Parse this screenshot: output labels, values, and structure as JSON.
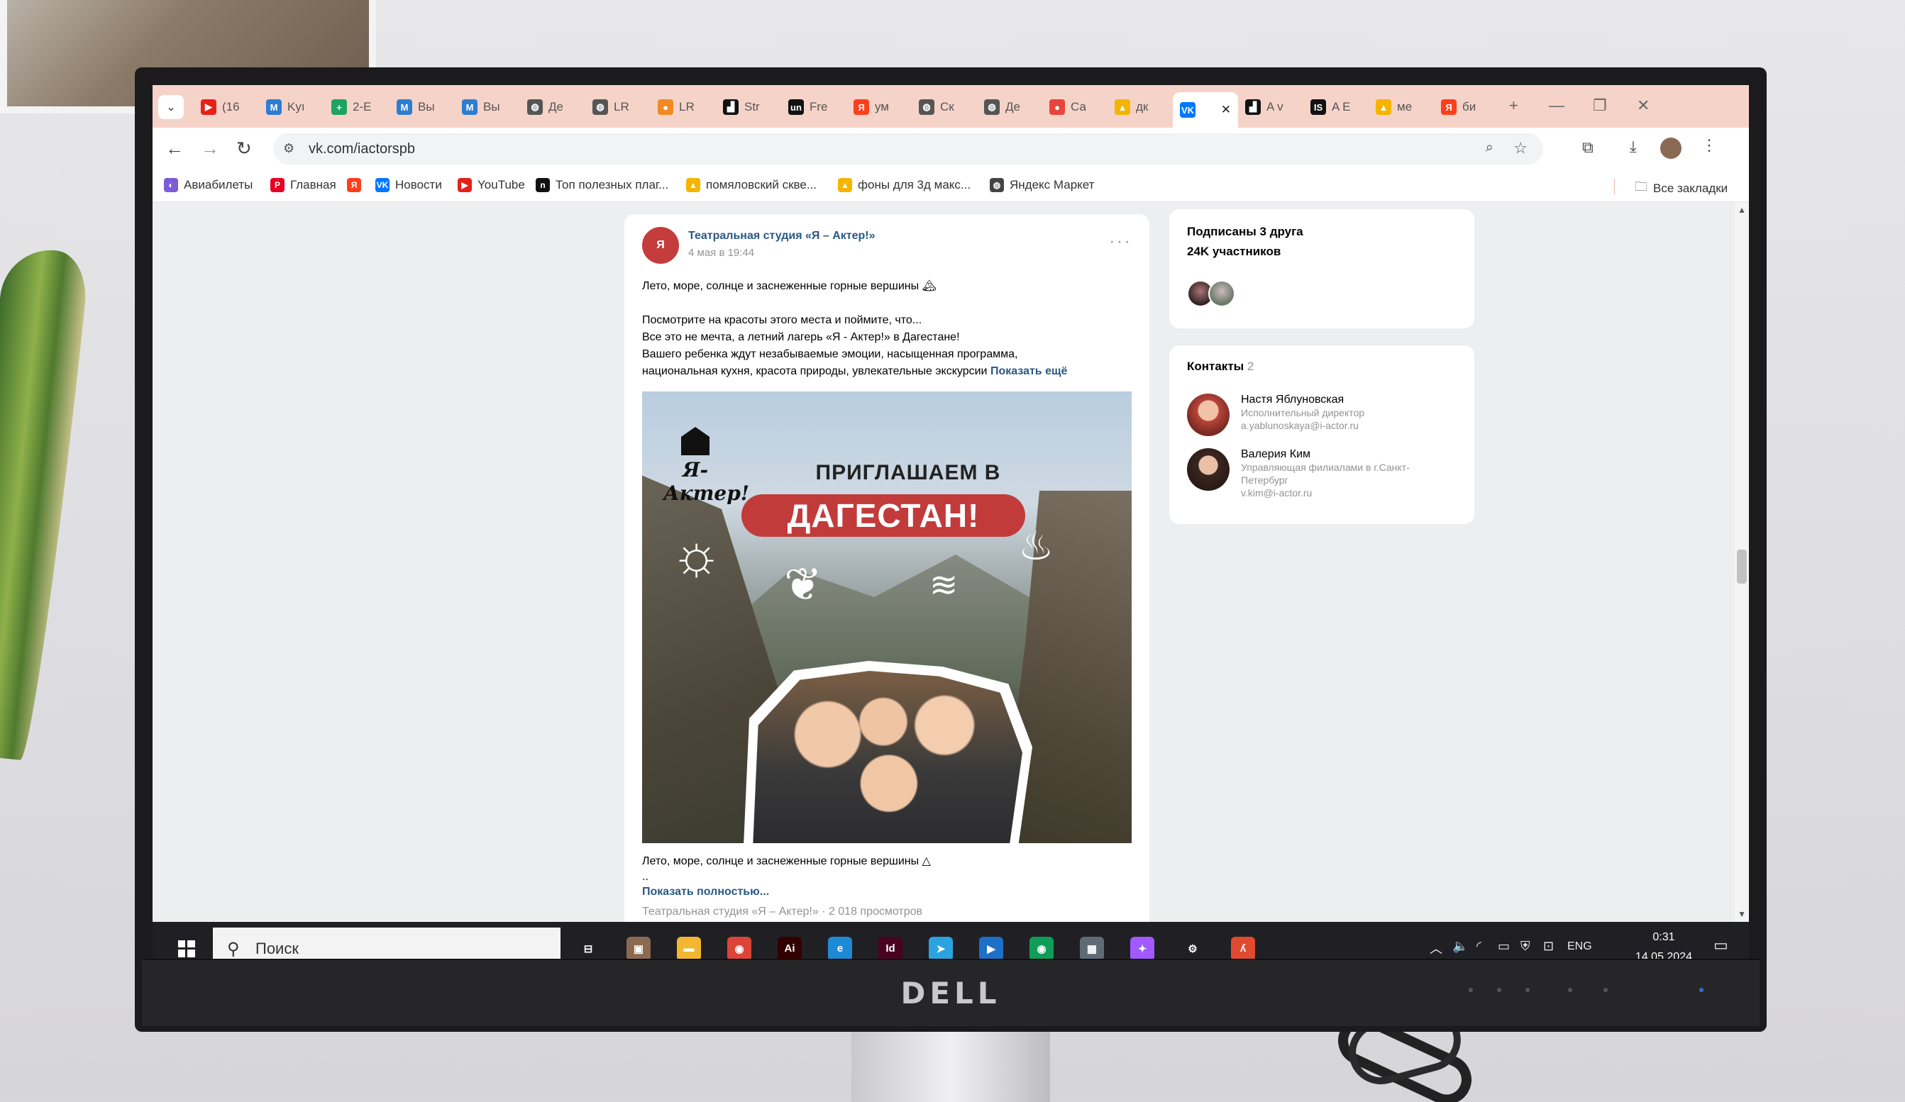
{
  "browser": {
    "tabs": [
      {
        "label": "(16",
        "icon": "youtube-icon",
        "color": "#e62117",
        "glyph": "▶"
      },
      {
        "label": "Kyı",
        "icon": "m-icon",
        "color": "#2d7dd2",
        "glyph": "M"
      },
      {
        "label": "2-E",
        "icon": "sheets-icon",
        "color": "#1ea362",
        "glyph": "+"
      },
      {
        "label": "Вы",
        "icon": "m-icon",
        "color": "#2d7dd2",
        "glyph": "M"
      },
      {
        "label": "Вы",
        "icon": "m-icon",
        "color": "#2d7dd2",
        "glyph": "M"
      },
      {
        "label": "Де",
        "icon": "globe-icon",
        "color": "#555555",
        "glyph": "◍"
      },
      {
        "label": "LR",
        "icon": "globe-icon",
        "color": "#555555",
        "glyph": "◍"
      },
      {
        "label": "LR",
        "icon": "lr-icon",
        "color": "#f08a24",
        "glyph": "●"
      },
      {
        "label": "Str",
        "icon": "str-icon",
        "color": "#111111",
        "glyph": "▟"
      },
      {
        "label": "Fre",
        "icon": "unsplash-icon",
        "color": "#111111",
        "glyph": "un"
      },
      {
        "label": "ум",
        "icon": "yandex-icon",
        "color": "#fc3f1d",
        "glyph": "Я"
      },
      {
        "label": "Ск",
        "icon": "globe-icon",
        "color": "#555555",
        "glyph": "◍"
      },
      {
        "label": "Де",
        "icon": "globe-icon",
        "color": "#555555",
        "glyph": "◍"
      },
      {
        "label": "Са",
        "icon": "maps-pin-icon",
        "color": "#e8453c",
        "glyph": "●"
      },
      {
        "label": "дк",
        "icon": "image-icon",
        "color": "#f5b400",
        "glyph": "▲"
      },
      {
        "label": "",
        "icon": "vk-icon",
        "color": "#0077ff",
        "glyph": "VK",
        "active": true
      },
      {
        "label": "A v",
        "icon": "str-icon",
        "color": "#111111",
        "glyph": "▟"
      },
      {
        "label": "A E",
        "icon": "is-icon",
        "color": "#111111",
        "glyph": "IS"
      },
      {
        "label": "ме",
        "icon": "image-icon",
        "color": "#f5b400",
        "glyph": "▲"
      },
      {
        "label": "би",
        "icon": "yandex-icon",
        "color": "#fc3f1d",
        "glyph": "Я"
      }
    ],
    "url": "vk.com/iactorspb",
    "bookmarks": [
      {
        "label": "Авиабилеты",
        "icon": "aviasales-icon",
        "color": "#7b5cd6",
        "glyph": "◐"
      },
      {
        "label": "Главная",
        "icon": "pinterest-icon",
        "color": "#e60023",
        "glyph": "P"
      },
      {
        "label": "",
        "icon": "yandex-icon",
        "color": "#fc3f1d",
        "glyph": "Я"
      },
      {
        "label": "Новости",
        "icon": "vk-icon",
        "color": "#0077ff",
        "glyph": "VK"
      },
      {
        "label": "YouTube",
        "icon": "youtube-icon",
        "color": "#e62117",
        "glyph": "▶"
      },
      {
        "label": "Топ полезных плаг...",
        "icon": "n-icon",
        "color": "#111111",
        "glyph": "n"
      },
      {
        "label": "помяловский скве...",
        "icon": "image-icon",
        "color": "#f5b400",
        "glyph": "▲"
      },
      {
        "label": "фоны для 3д макс...",
        "icon": "image-icon",
        "color": "#f5b400",
        "glyph": "▲"
      },
      {
        "label": "Яндекс Маркет",
        "icon": "globe-icon",
        "color": "#444444",
        "glyph": "◍"
      }
    ],
    "all_bookmarks": "Все закладки"
  },
  "post": {
    "author": "Театральная студия «Я – Актер!»",
    "date": "4 мая в 19:44",
    "lines": [
      "Лето, море, солнце и заснеженные горные вершины 🏔",
      "",
      "Посмотрите на красоты этого места и поймите, что...",
      "Все это не мечта, а летний лагерь «Я - Актер!» в Дагестане!",
      "Вашего ребенка ждут незабываемые эмоции, насыщенная программа,"
    ],
    "last_line": "национальная кухня, красота природы, увлекательные экскурсии",
    "show_more": "Показать ещё",
    "image": {
      "logo": "Я-Актер!",
      "headline": "ПРИГЛАШАЕМ В",
      "pill": "ДАГЕСТАН!"
    },
    "caption": "Лето, море, солнце и заснеженные горные вершины △",
    "ellipsis": "..",
    "show_full": "Показать полностью...",
    "meta": "Театральная студия «Я – Актер!» · 2 018 просмотров"
  },
  "sidebar": {
    "friends_line": "Подписаны 3 друга",
    "members_line": "24K участников",
    "contacts_title": "Контакты",
    "contacts_count": "2",
    "contacts": [
      {
        "name": "Настя Яблуновская",
        "role": "Исполнительный директор",
        "email": "a.yablunoskaya@i-actor.ru"
      },
      {
        "name": "Валерия Ким",
        "role": "Управляющая филиалами в г.Санкт-Петербург",
        "email": "v.kim@i-actor.ru"
      }
    ]
  },
  "taskbar": {
    "search_placeholder": "Поиск",
    "apps": [
      {
        "name": "task-view",
        "glyph": "⊟",
        "color": "#202024"
      },
      {
        "name": "photos",
        "glyph": "▣",
        "color": "#8a6a50"
      },
      {
        "name": "file-explorer",
        "glyph": "▬",
        "color": "#f2b630"
      },
      {
        "name": "chrome",
        "glyph": "◉",
        "color": "#db4437"
      },
      {
        "name": "illustrator",
        "glyph": "Ai",
        "color": "#330000"
      },
      {
        "name": "edge",
        "glyph": "e",
        "color": "#1e8ad6"
      },
      {
        "name": "indesign",
        "glyph": "Id",
        "color": "#49021f"
      },
      {
        "name": "telegram",
        "glyph": "➤",
        "color": "#2aa3df"
      },
      {
        "name": "video-player",
        "glyph": "▶",
        "color": "#1e6fc8"
      },
      {
        "name": "chrome-profile",
        "glyph": "◉",
        "color": "#0f9d58"
      },
      {
        "name": "calculator",
        "glyph": "▦",
        "color": "#5f6b75"
      },
      {
        "name": "figma",
        "glyph": "✦",
        "color": "#a259ff"
      },
      {
        "name": "settings",
        "glyph": "⚙",
        "color": "#202024"
      },
      {
        "name": "app-red",
        "glyph": "ʎ",
        "color": "#e04a2f"
      }
    ],
    "language": "ENG",
    "time": "0:31",
    "date": "14.05.2024"
  },
  "monitor_brand": "DELL"
}
